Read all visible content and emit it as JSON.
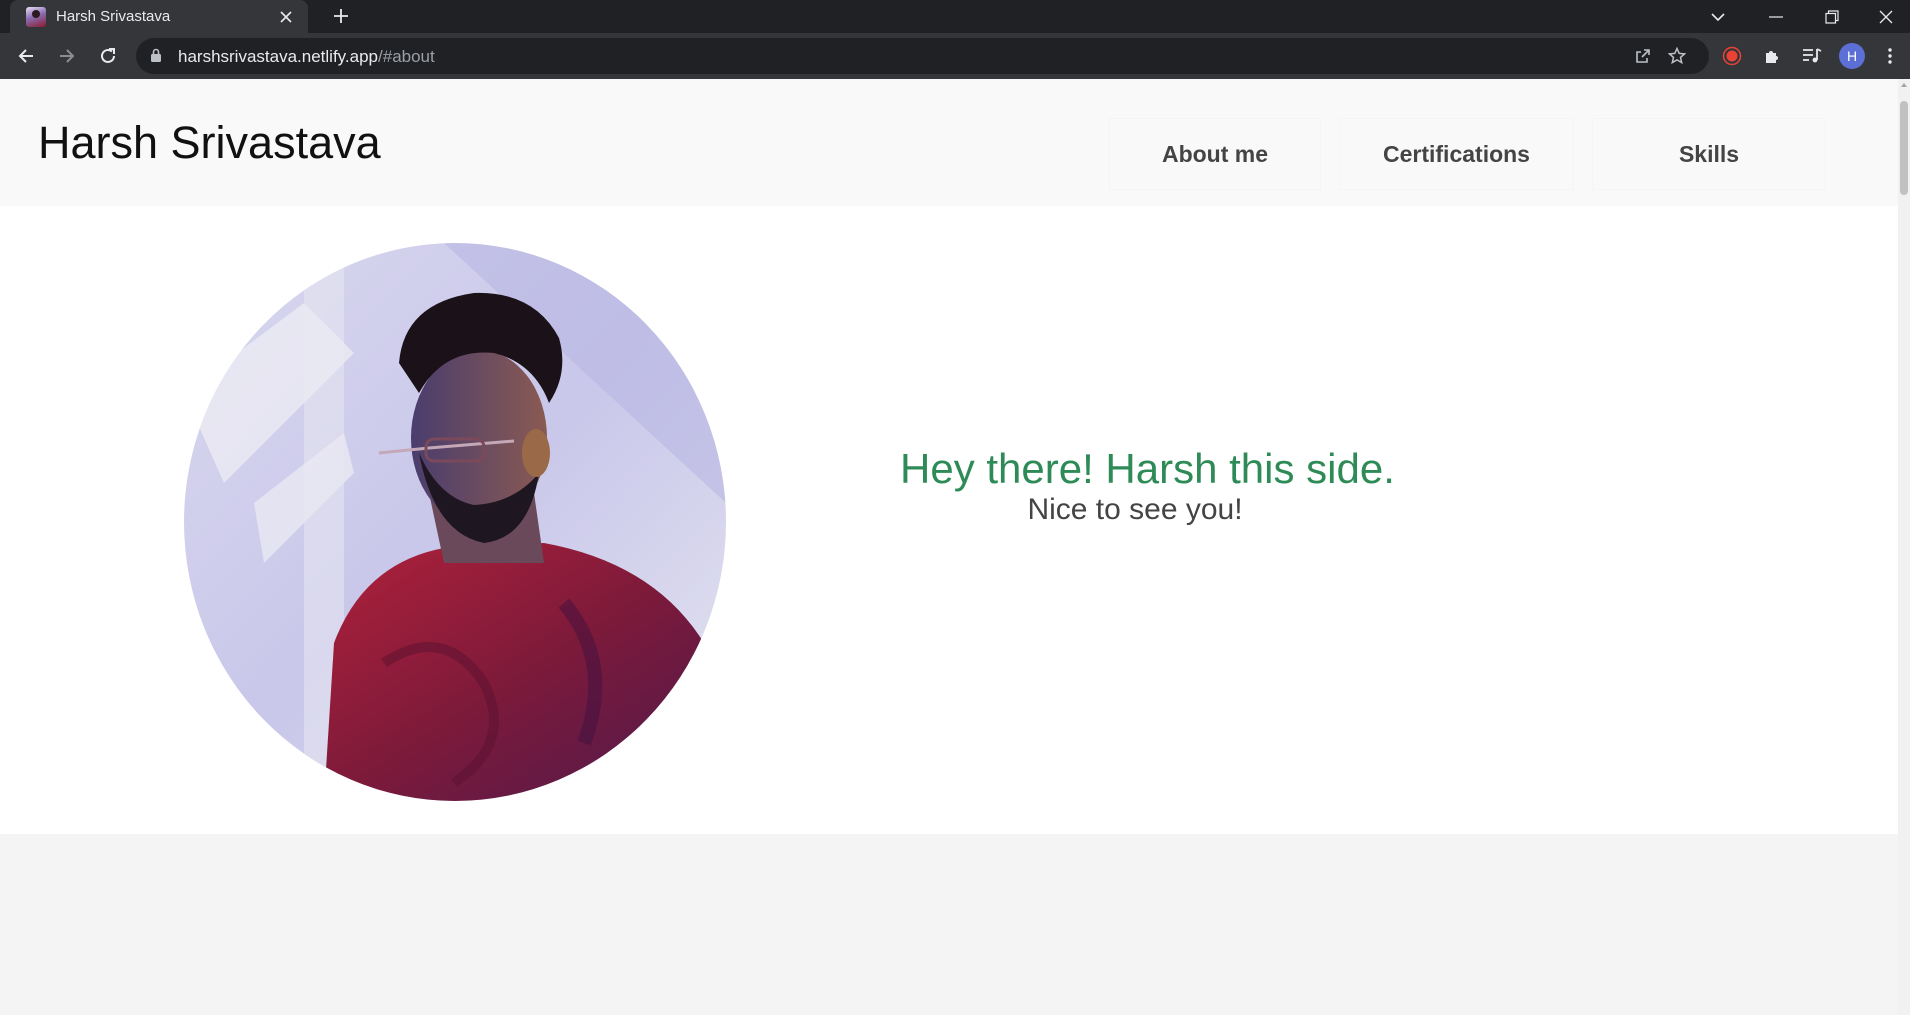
{
  "browser": {
    "tab": {
      "title": "Harsh Srivastava"
    },
    "url": {
      "host": "harshsrivastava.netlify.app",
      "path": "/#about"
    },
    "profile_initial": "H"
  },
  "site": {
    "name": "Harsh Srivastava",
    "nav": [
      {
        "label": "About me"
      },
      {
        "label": "Certifications"
      },
      {
        "label": "Skills"
      }
    ],
    "about": {
      "greeting": "Hey there! Harsh this side.",
      "subgreeting": "Nice to see you!"
    }
  },
  "colors": {
    "greeting": "#2e8b57",
    "nav_text": "#444444",
    "header_bg": "#f9f9f9",
    "footer_bg": "#f4f4f4"
  }
}
